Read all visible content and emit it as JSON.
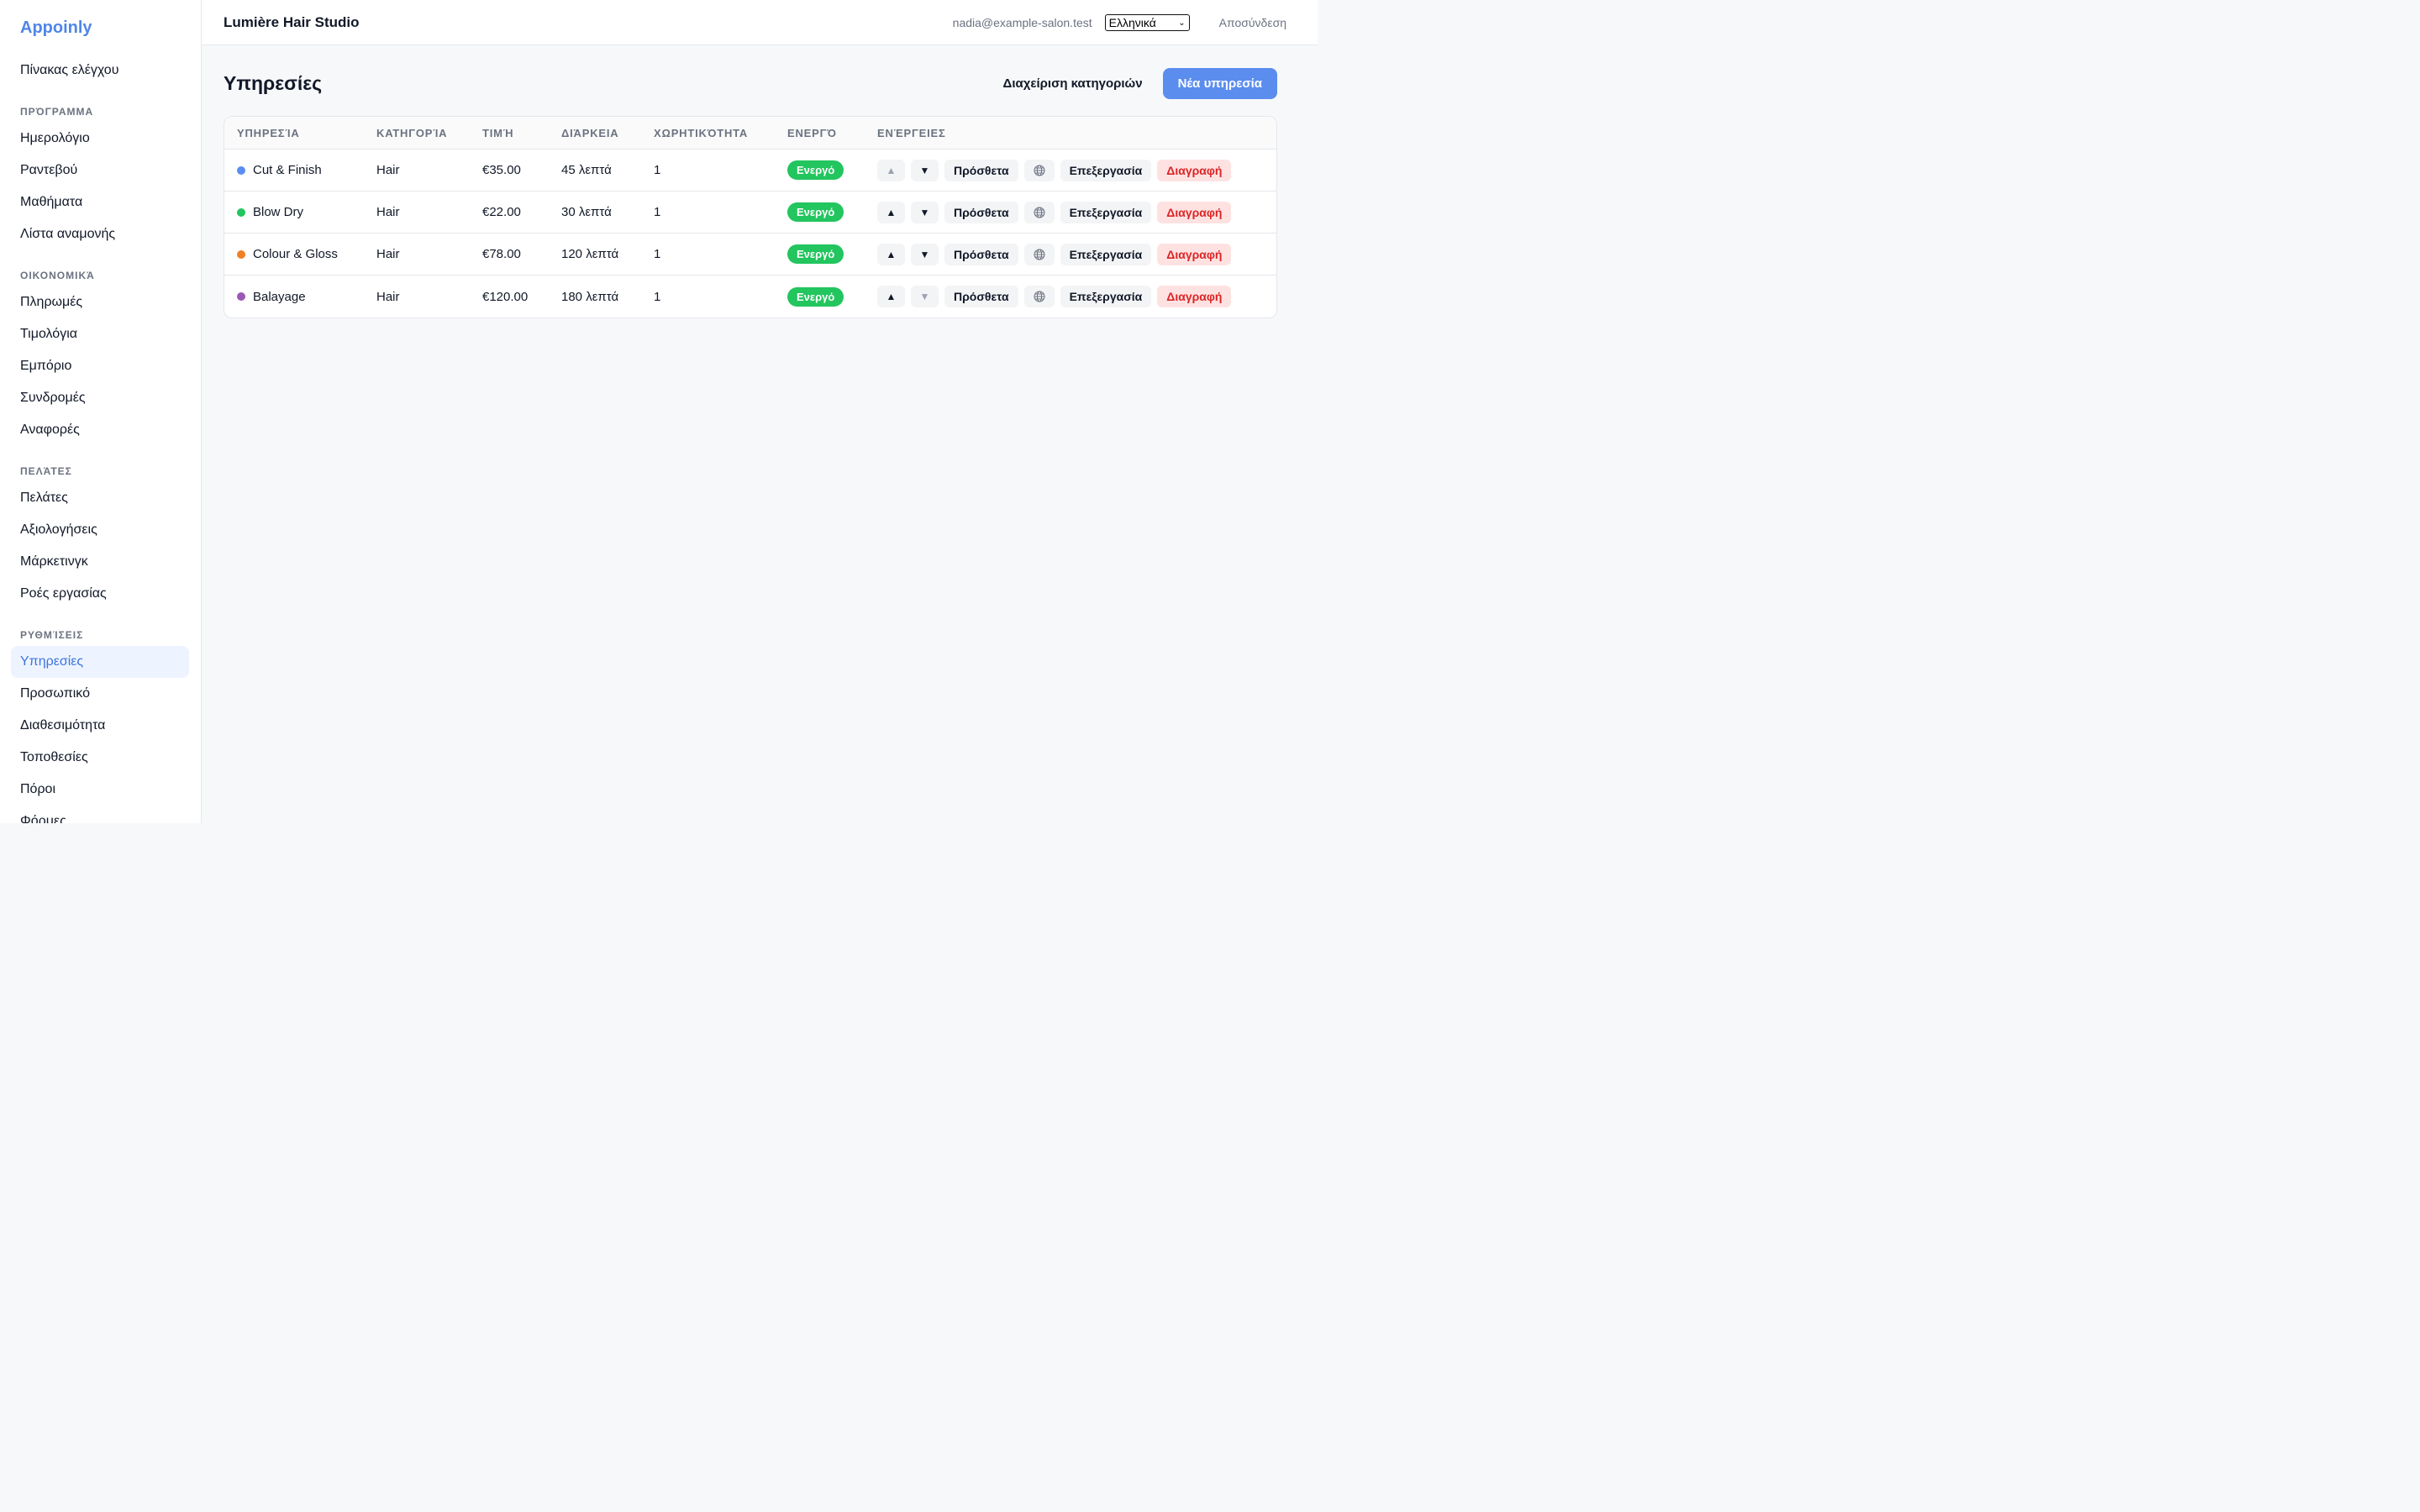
{
  "brand": "Appoinly",
  "nav": {
    "dashboard": "Πίνακας ελέγχου",
    "sections": [
      {
        "title": "ΠΡΌΓΡΑΜΜΑ",
        "items": [
          "Ημερολόγιο",
          "Ραντεβού",
          "Μαθήματα",
          "Λίστα αναμονής"
        ]
      },
      {
        "title": "ΟΙΚΟΝΟΜΙΚΆ",
        "items": [
          "Πληρωμές",
          "Τιμολόγια",
          "Εμπόριο",
          "Συνδρομές",
          "Αναφορές"
        ]
      },
      {
        "title": "ΠΕΛΆΤΕΣ",
        "items": [
          "Πελάτες",
          "Αξιολογήσεις",
          "Μάρκετινγκ",
          "Ροές εργασίας"
        ]
      },
      {
        "title": "ΡΥΘΜΊΣΕΙΣ",
        "items": [
          "Υπηρεσίες",
          "Προσωπικό",
          "Διαθεσιμότητα",
          "Τοποθεσίες",
          "Πόροι",
          "Φόρμες"
        ]
      }
    ],
    "active": "Υπηρεσίες"
  },
  "topbar": {
    "studio": "Lumière Hair Studio",
    "email": "nadia@example-salon.test",
    "language": "Ελληνικά",
    "logout": "Αποσύνδεση"
  },
  "page": {
    "title": "Υπηρεσίες",
    "manage_categories": "Διαχείριση κατηγοριών",
    "new_service": "Νέα υπηρεσία"
  },
  "table": {
    "headers": [
      "Υπηρεσία",
      "Κατηγορία",
      "Τιμή",
      "Διάρκεια",
      "Χωρητικότητα",
      "Ενεργό",
      "Ενέργειες"
    ],
    "actions": {
      "addons": "Πρόσθετα",
      "edit": "Επεξεργασία",
      "delete": "Διαγραφή",
      "up": "▲",
      "down": "▼"
    },
    "rows": [
      {
        "name": "Cut & Finish",
        "color": "#5b8def",
        "category": "Hair",
        "price": "€35.00",
        "duration": "45 λεπτά",
        "capacity": "1",
        "status": "Ενεργό",
        "up_disabled": true,
        "down_disabled": false
      },
      {
        "name": "Blow Dry",
        "color": "#22c55e",
        "category": "Hair",
        "price": "€22.00",
        "duration": "30 λεπτά",
        "capacity": "1",
        "status": "Ενεργό",
        "up_disabled": false,
        "down_disabled": false
      },
      {
        "name": "Colour & Gloss",
        "color": "#f07f22",
        "category": "Hair",
        "price": "€78.00",
        "duration": "120 λεπτά",
        "capacity": "1",
        "status": "Ενεργό",
        "up_disabled": false,
        "down_disabled": false
      },
      {
        "name": "Balayage",
        "color": "#9b59b6",
        "category": "Hair",
        "price": "€120.00",
        "duration": "180 λεπτά",
        "capacity": "1",
        "status": "Ενεργό",
        "up_disabled": false,
        "down_disabled": true
      }
    ]
  }
}
